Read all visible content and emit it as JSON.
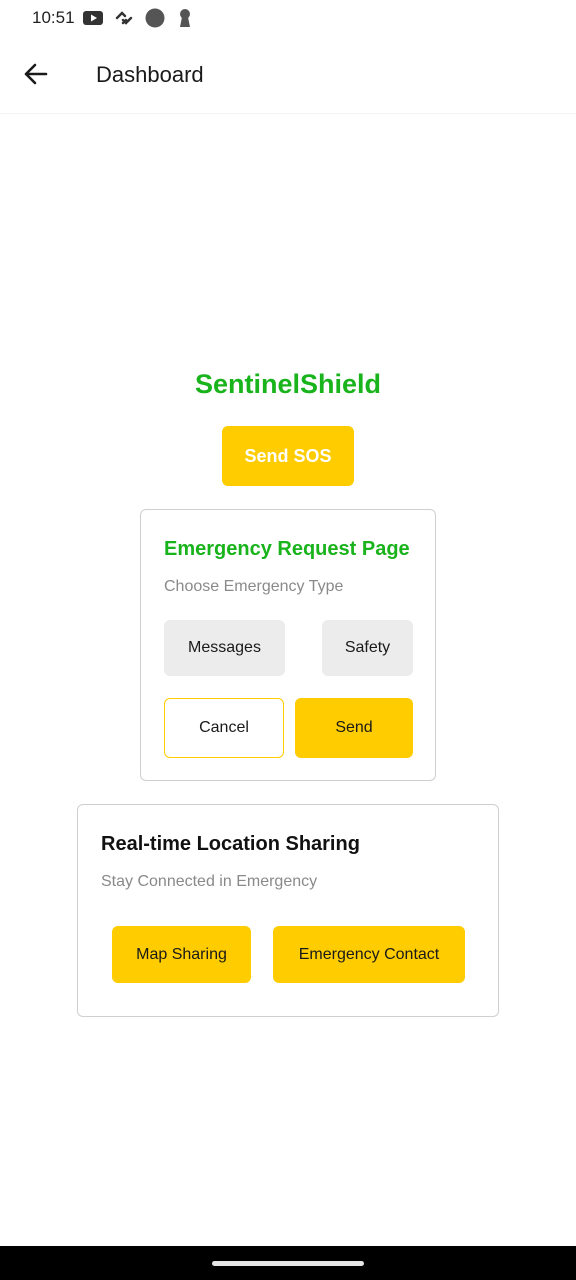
{
  "status_bar": {
    "time": "10:51",
    "icons": [
      "youtube-icon",
      "link-icon",
      "circle-icon",
      "keyhole-icon"
    ]
  },
  "app_bar": {
    "title": "Dashboard",
    "back_icon": "arrow-left-icon"
  },
  "brand": {
    "name": "SentinelShield",
    "sos_label": "Send SOS"
  },
  "emergency_card": {
    "title": "Emergency Request Page",
    "subtitle": "Choose Emergency Type",
    "type_options": [
      "Messages",
      "Safety"
    ],
    "cancel_label": "Cancel",
    "send_label": "Send"
  },
  "location_card": {
    "title": "Real-time Location Sharing",
    "subtitle": "Stay Connected in Emergency",
    "map_label": "Map Sharing",
    "contact_label": "Emergency Contact"
  },
  "colors": {
    "accent_yellow": "#ffcc00",
    "brand_green": "#19b31c",
    "grey_button": "#ececec",
    "muted_text": "#8a8a8a"
  }
}
